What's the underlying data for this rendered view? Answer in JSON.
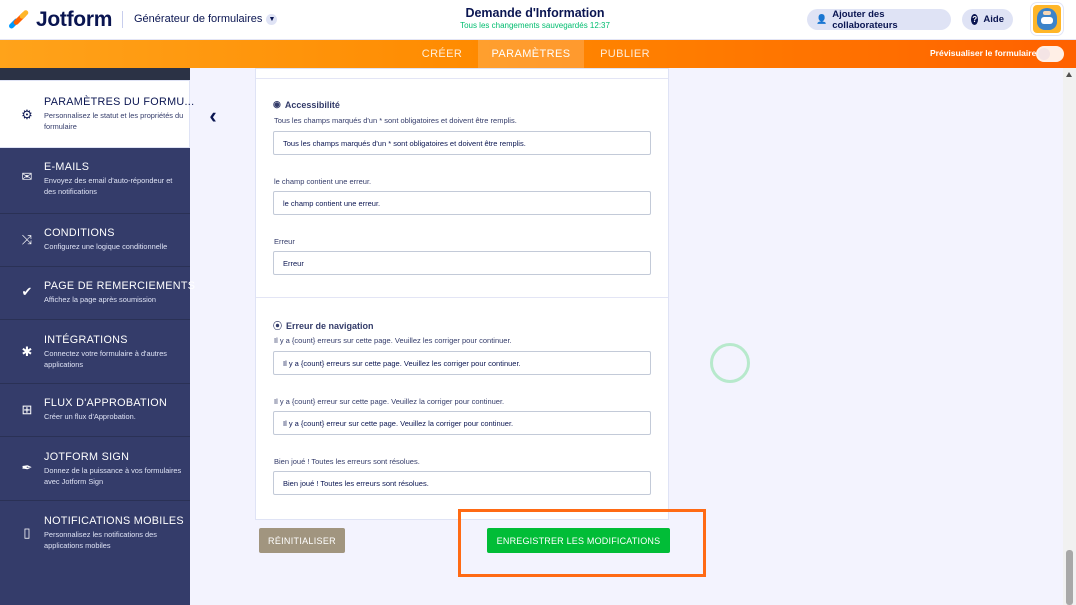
{
  "header": {
    "logo_text": "Jotform",
    "builder_label": "Générateur de formulaires",
    "form_title": "Demande d'Information",
    "save_status": "Tous les changements sauvegardés 12:37",
    "collab_label": "Ajouter des collaborateurs",
    "help_label": "Aide"
  },
  "nav": {
    "tabs": [
      "CRÉER",
      "PARAMÈTRES",
      "PUBLIER"
    ],
    "active_tab": "PARAMÈTRES",
    "preview_label": "Prévisualiser le formulaire"
  },
  "sidebar": {
    "items": [
      {
        "title": "PARAMÈTRES DU FORMU...",
        "desc": "Personnalisez le statut et les propriétés du formulaire",
        "icon": "gear-icon"
      },
      {
        "title": "E-MAILS",
        "desc": "Envoyez des email d'auto-répondeur et des notifications",
        "icon": "envelope-icon"
      },
      {
        "title": "CONDITIONS",
        "desc": "Configurez une logique conditionnelle",
        "icon": "shuffle-icon"
      },
      {
        "title": "PAGE DE REMERCIEMENTS",
        "desc": "Affichez la page après soumission",
        "icon": "check-circle-icon"
      },
      {
        "title": "INTÉGRATIONS",
        "desc": "Connectez votre formulaire à d'autres applications",
        "icon": "puzzle-icon"
      },
      {
        "title": "FLUX D'APPROBATION",
        "desc": "Créer un flux d'Approbation.",
        "icon": "flow-icon"
      },
      {
        "title": "JOTFORM SIGN",
        "desc": "Donnez de la puissance à vos formulaires avec Jotform Sign",
        "icon": "pen-icon"
      },
      {
        "title": "NOTIFICATIONS MOBILES",
        "desc": "Personnalisez les notifications des applications mobiles",
        "icon": "mobile-icon"
      }
    ]
  },
  "accessibility": {
    "title": "Accessibilité",
    "fields": [
      {
        "label": "Tous les champs marqués d'un * sont obligatoires et doivent être remplis.",
        "value": "Tous les champs marqués d'un * sont obligatoires et doivent être remplis."
      },
      {
        "label": "le champ contient une erreur.",
        "value": "le champ contient une erreur."
      },
      {
        "label": "Erreur",
        "value": "Erreur"
      }
    ]
  },
  "navigation_error": {
    "title": "Erreur de navigation",
    "fields": [
      {
        "label": "Il y a {count} erreurs sur cette page. Veuillez les corriger pour continuer.",
        "value": "Il y a {count} erreurs sur cette page. Veuillez les corriger pour continuer."
      },
      {
        "label": "Il y a {count} erreur sur cette page. Veuillez la corriger pour continuer.",
        "value": "Il y a {count} erreur sur cette page. Veuillez la corriger pour continuer."
      },
      {
        "label": "Bien joué ! Toutes les erreurs sont résolues.",
        "value": "Bien joué ! Toutes les erreurs sont résolues."
      }
    ]
  },
  "actions": {
    "reset_label": "RÉINITIALISER",
    "save_label": "ENREGISTRER LES MODIFICATIONS"
  },
  "colors": {
    "accent_orange": "#ff6100",
    "sidebar_bg": "#343c6a",
    "save_green": "#01bd37",
    "reset_tan": "#a1957f"
  }
}
